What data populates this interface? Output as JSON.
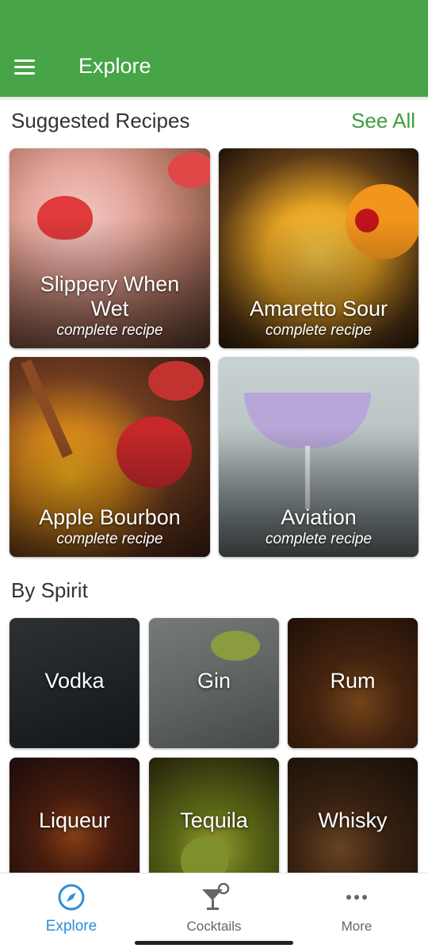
{
  "app_bar": {
    "title": "Explore",
    "menu_icon": "hamburger-menu-icon",
    "color": "#47a447"
  },
  "suggested": {
    "title": "Suggested Recipes",
    "see_all": "See All",
    "accent": "#3f9c3f",
    "recipes": [
      {
        "name": "Slippery When Wet",
        "sub": "complete recipe"
      },
      {
        "name": "Amaretto Sour",
        "sub": "complete recipe"
      },
      {
        "name": "Apple Bourbon",
        "sub": "complete recipe"
      },
      {
        "name": "Aviation",
        "sub": "complete recipe"
      }
    ]
  },
  "by_spirit": {
    "title": "By Spirit",
    "items": [
      {
        "label": "Vodka"
      },
      {
        "label": "Gin"
      },
      {
        "label": "Rum"
      },
      {
        "label": "Liqueur"
      },
      {
        "label": "Tequila"
      },
      {
        "label": "Whisky"
      }
    ]
  },
  "bottom_nav": {
    "items": [
      {
        "label": "Explore",
        "icon": "compass-icon",
        "active": true
      },
      {
        "label": "Cocktails",
        "icon": "cocktail-glass-icon",
        "active": false
      },
      {
        "label": "More",
        "icon": "more-dots-icon",
        "active": false
      }
    ],
    "active_color": "#2d8ed8"
  }
}
